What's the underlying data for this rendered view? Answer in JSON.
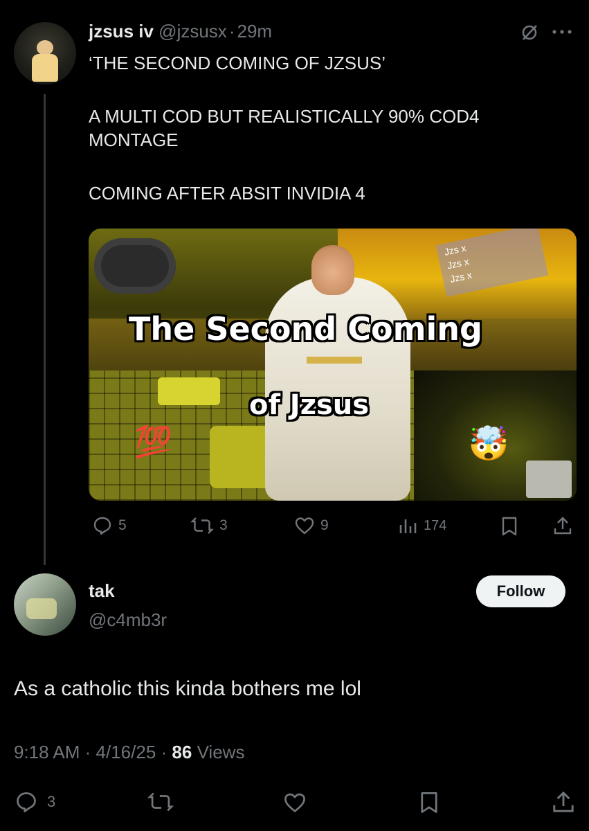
{
  "tweet": {
    "author_name": "jzsus iv",
    "author_handle": "@jzsusx",
    "separator": "·",
    "time_ago": "29m",
    "text_line1": "‘THE SECOND COMING OF JZSUS’",
    "text_line2": "A MULTI COD BUT REALISTICALLY 90% COD4",
    "text_line3": "MONTAGE",
    "text_line4": "COMING AFTER ABSIT INVIDIA 4",
    "media": {
      "title_line1": "The Second Coming",
      "title_line2": "of Jzsus",
      "overlay_tags": [
        "Jzs x",
        "Jzs x",
        "Jzs x"
      ],
      "emoji_hundred": "💯",
      "emoji_mind_blown": "🤯"
    },
    "actions": {
      "replies": "5",
      "reposts": "3",
      "likes": "9",
      "views": "174"
    }
  },
  "reply": {
    "author_name": "tak",
    "author_handle": "@c4mb3r",
    "follow_label": "Follow",
    "text": "As a catholic this kinda bothers me lol",
    "time": "9:18 AM",
    "date": "4/16/25",
    "view_count": "86",
    "views_label": "Views",
    "actions": {
      "replies": "3"
    }
  },
  "colors": {
    "background": "#000000",
    "text": "#e7e9ea",
    "muted": "#71767b",
    "follow_bg": "#eff3f4"
  },
  "icons": [
    "grok-icon",
    "more-icon",
    "reply-icon",
    "repost-icon",
    "like-icon",
    "views-icon",
    "bookmark-icon",
    "share-icon"
  ]
}
